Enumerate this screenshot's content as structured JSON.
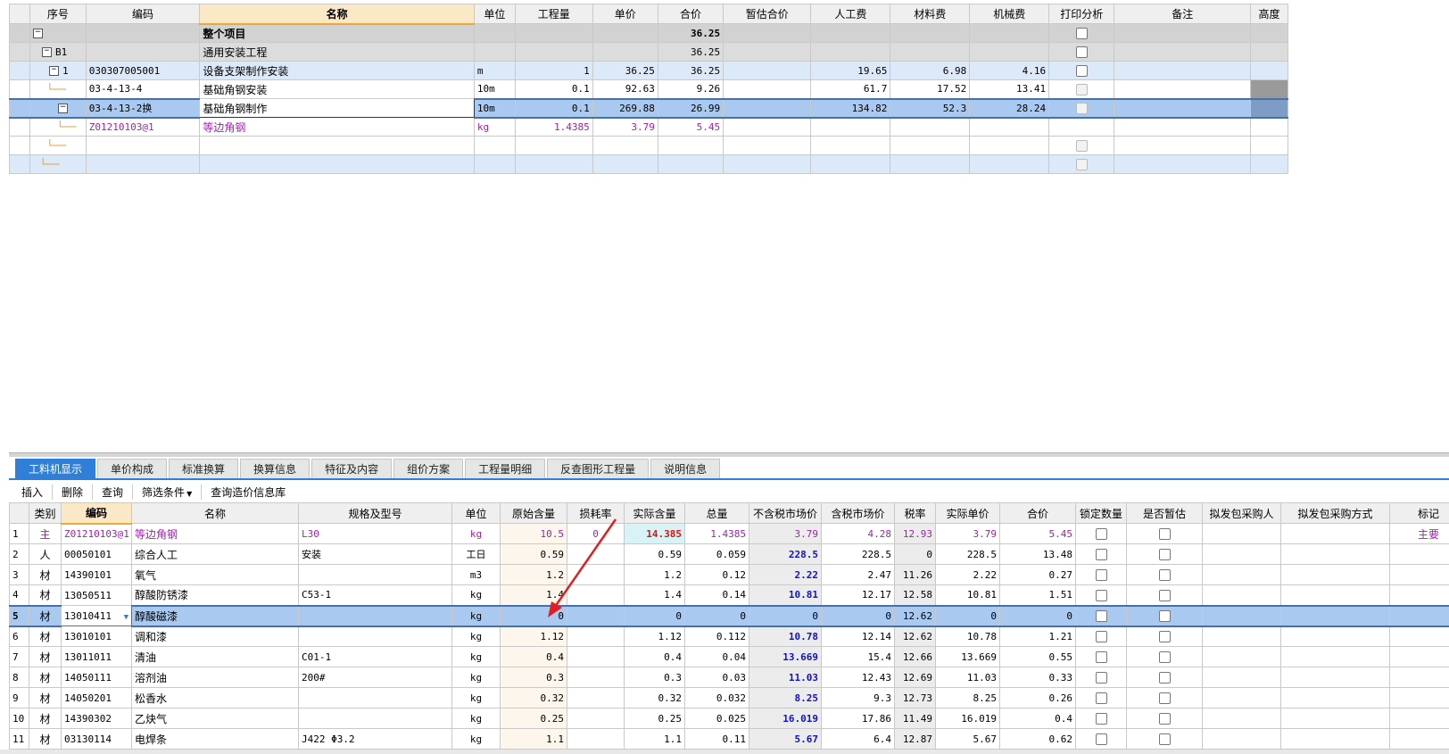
{
  "upper": {
    "headers": [
      "序号",
      "编码",
      "名称",
      "单位",
      "工程量",
      "单价",
      "合价",
      "暂估合价",
      "人工费",
      "材料费",
      "机械费",
      "打印分析",
      "备注",
      "高度"
    ],
    "rows": [
      {
        "seq": "",
        "code": "",
        "name": "整个项目",
        "unit": "",
        "qty": "",
        "price": "",
        "total": "36.25",
        "est": "",
        "labor": "",
        "material": "",
        "machine": "",
        "note": ""
      },
      {
        "seq": "B1",
        "code": "",
        "name": "通用安装工程",
        "unit": "",
        "qty": "",
        "price": "",
        "total": "36.25",
        "est": "",
        "labor": "",
        "material": "",
        "machine": "",
        "note": ""
      },
      {
        "seq": "1",
        "code": "030307005001",
        "name": "设备支架制作安装",
        "unit": "m",
        "qty": "1",
        "price": "36.25",
        "total": "36.25",
        "est": "",
        "labor": "19.65",
        "material": "6.98",
        "machine": "4.16",
        "note": ""
      },
      {
        "seq": "",
        "code": "03-4-13-4",
        "name": "基础角钢安装",
        "unit": "10m",
        "qty": "0.1",
        "price": "92.63",
        "total": "9.26",
        "est": "",
        "labor": "61.7",
        "material": "17.52",
        "machine": "13.41",
        "note": ""
      },
      {
        "seq": "",
        "code": "03-4-13-2换",
        "name": "基础角钢制作",
        "unit": "10m",
        "qty": "0.1",
        "price": "269.88",
        "total": "26.99",
        "est": "",
        "labor": "134.82",
        "material": "52.3",
        "machine": "28.24",
        "note": ""
      },
      {
        "seq": "",
        "code": "Z01210103@1",
        "name": "等边角钢",
        "unit": "kg",
        "qty": "1.4385",
        "price": "3.79",
        "total": "5.45",
        "est": "",
        "labor": "",
        "material": "",
        "machine": "",
        "note": ""
      }
    ]
  },
  "tabs": [
    "工料机显示",
    "单价构成",
    "标准换算",
    "换算信息",
    "特征及内容",
    "组价方案",
    "工程量明细",
    "反查图形工程量",
    "说明信息"
  ],
  "toolbar": {
    "insert": "插入",
    "delete": "删除",
    "query": "查询",
    "filter": "筛选条件",
    "query_db": "查询造价信息库"
  },
  "lower": {
    "headers": [
      "",
      "类别",
      "编码",
      "名称",
      "规格及型号",
      "单位",
      "原始含量",
      "损耗率",
      "实际含量",
      "总量",
      "不含税市场价",
      "含税市场价",
      "税率",
      "实际单价",
      "合价",
      "锁定数量",
      "是否暂估",
      "拟发包采购人",
      "拟发包采购方式",
      "标记"
    ],
    "rows": [
      {
        "no": "1",
        "type": "主",
        "code": "Z01210103@1",
        "name": "等边角钢",
        "spec": "L30",
        "unit": "kg",
        "orig": "10.5",
        "loss": "0",
        "actual": "14.385",
        "total": "1.4385",
        "price_ex": "3.79",
        "price_in": "4.28",
        "tax": "12.93",
        "unit_price": "3.79",
        "sum": "5.45",
        "mark": "主要"
      },
      {
        "no": "2",
        "type": "人",
        "code": "00050101",
        "name": "综合人工",
        "spec": "安装",
        "unit": "工日",
        "orig": "0.59",
        "loss": "",
        "actual": "0.59",
        "total": "0.059",
        "price_ex": "228.5",
        "price_in": "228.5",
        "tax": "0",
        "unit_price": "228.5",
        "sum": "13.48",
        "mark": ""
      },
      {
        "no": "3",
        "type": "材",
        "code": "14390101",
        "name": "氧气",
        "spec": "",
        "unit": "m3",
        "orig": "1.2",
        "loss": "",
        "actual": "1.2",
        "total": "0.12",
        "price_ex": "2.22",
        "price_in": "2.47",
        "tax": "11.26",
        "unit_price": "2.22",
        "sum": "0.27",
        "mark": ""
      },
      {
        "no": "4",
        "type": "材",
        "code": "13050511",
        "name": "醇酸防锈漆",
        "spec": "C53-1",
        "unit": "kg",
        "orig": "1.4",
        "loss": "",
        "actual": "1.4",
        "total": "0.14",
        "price_ex": "10.81",
        "price_in": "12.17",
        "tax": "12.58",
        "unit_price": "10.81",
        "sum": "1.51",
        "mark": ""
      },
      {
        "no": "5",
        "type": "材",
        "code": "13010411",
        "name": "醇酸磁漆",
        "spec": "",
        "unit": "kg",
        "orig": "0",
        "loss": "",
        "actual": "0",
        "total": "0",
        "price_ex": "0",
        "price_in": "0",
        "tax": "12.62",
        "unit_price": "0",
        "sum": "0",
        "mark": ""
      },
      {
        "no": "6",
        "type": "材",
        "code": "13010101",
        "name": "调和漆",
        "spec": "",
        "unit": "kg",
        "orig": "1.12",
        "loss": "",
        "actual": "1.12",
        "total": "0.112",
        "price_ex": "10.78",
        "price_in": "12.14",
        "tax": "12.62",
        "unit_price": "10.78",
        "sum": "1.21",
        "mark": ""
      },
      {
        "no": "7",
        "type": "材",
        "code": "13011011",
        "name": "清油",
        "spec": "C01-1",
        "unit": "kg",
        "orig": "0.4",
        "loss": "",
        "actual": "0.4",
        "total": "0.04",
        "price_ex": "13.669",
        "price_in": "15.4",
        "tax": "12.66",
        "unit_price": "13.669",
        "sum": "0.55",
        "mark": ""
      },
      {
        "no": "8",
        "type": "材",
        "code": "14050111",
        "name": "溶剂油",
        "spec": "200#",
        "unit": "kg",
        "orig": "0.3",
        "loss": "",
        "actual": "0.3",
        "total": "0.03",
        "price_ex": "11.03",
        "price_in": "12.43",
        "tax": "12.69",
        "unit_price": "11.03",
        "sum": "0.33",
        "mark": ""
      },
      {
        "no": "9",
        "type": "材",
        "code": "14050201",
        "name": "松香水",
        "spec": "",
        "unit": "kg",
        "orig": "0.32",
        "loss": "",
        "actual": "0.32",
        "total": "0.032",
        "price_ex": "8.25",
        "price_in": "9.3",
        "tax": "12.73",
        "unit_price": "8.25",
        "sum": "0.26",
        "mark": ""
      },
      {
        "no": "10",
        "type": "材",
        "code": "14390302",
        "name": "乙炔气",
        "spec": "",
        "unit": "kg",
        "orig": "0.25",
        "loss": "",
        "actual": "0.25",
        "total": "0.025",
        "price_ex": "16.019",
        "price_in": "17.86",
        "tax": "11.49",
        "unit_price": "16.019",
        "sum": "0.4",
        "mark": ""
      },
      {
        "no": "11",
        "type": "材",
        "code": "03130114",
        "name": "电焊条",
        "spec": "J422 Φ3.2",
        "unit": "kg",
        "orig": "1.1",
        "loss": "",
        "actual": "1.1",
        "total": "0.11",
        "price_ex": "5.67",
        "price_in": "6.4",
        "tax": "12.87",
        "unit_price": "5.67",
        "sum": "0.62",
        "mark": ""
      }
    ]
  },
  "colors": {
    "accent": "#2f7fd8",
    "purple": "#a020b0",
    "blue_value": "#1010d0",
    "red_value": "#e01010",
    "arrow": "#e02020"
  }
}
